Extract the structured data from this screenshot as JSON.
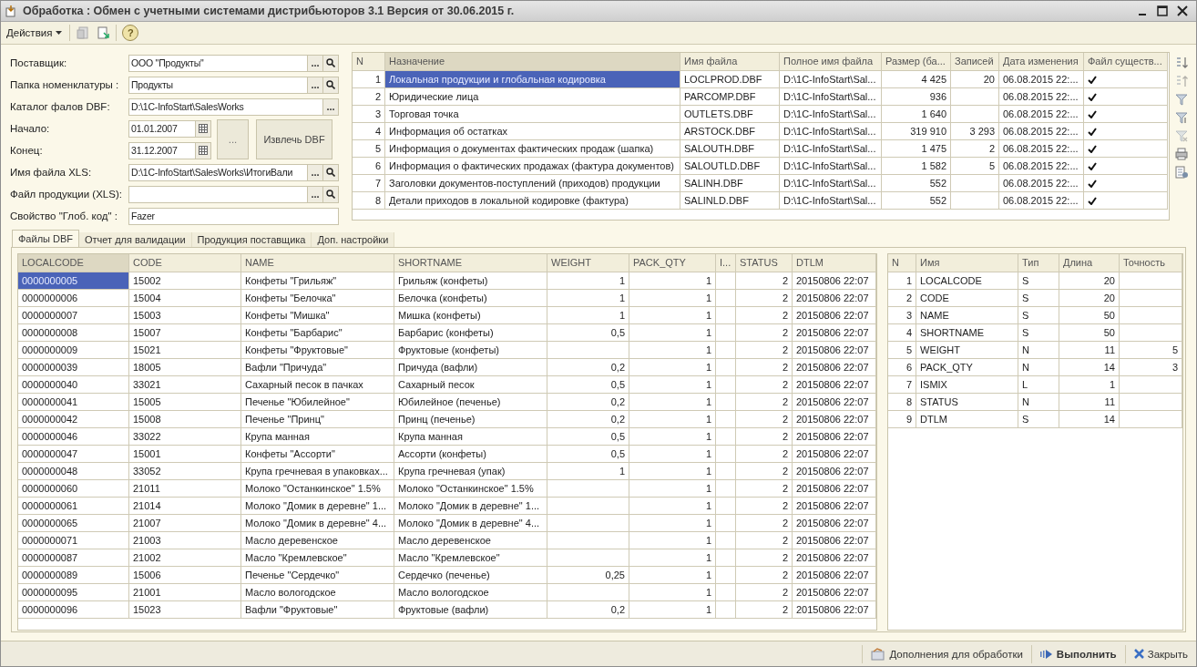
{
  "window": {
    "title": "Обработка : Обмен с учетными системами дистрибьюторов 3.1 Версия от 30.06.2015 г."
  },
  "toolbar": {
    "actions_menu": "Действия",
    "help": "?"
  },
  "form": {
    "fields": [
      {
        "label": "Поставщик:",
        "value": "ООО \"Продукты\"",
        "kind": "lookup"
      },
      {
        "label": "Папка номенклатуры :",
        "value": "Продукты",
        "kind": "lookup"
      },
      {
        "label": "Каталог фалов DBF:",
        "value": "D:\\1C-InfoStart\\SalesWorks",
        "kind": "select"
      },
      {
        "label": "Начало:",
        "value": "01.01.2007",
        "kind": "date"
      },
      {
        "label": "Конец:",
        "value": "31.12.2007",
        "kind": "date"
      },
      {
        "label": "Имя файла XLS:",
        "value": "D:\\1C-InfoStart\\SalesWorks\\ИтогиВали",
        "kind": "lookup"
      },
      {
        "label": "Файл продукции (XLS):",
        "kind": "lookup"
      },
      {
        "label": "Свойство \"Глоб. код\" :",
        "value": "Fazer",
        "kind": "text"
      }
    ],
    "buttons": [
      "...",
      "Извлечь DBF"
    ],
    "select_button": "..."
  },
  "files_table": {
    "columns": [
      "N",
      "Назначение",
      "Имя файла",
      "Полное имя файла",
      "Размер (ба...",
      "Записей",
      "Дата изменения",
      "Файл существ..."
    ],
    "rows": [
      {
        "n": "1",
        "purpose": "Локальная продукции и глобальная кодировка",
        "file": "LOCLPROD.DBF",
        "full_name": "D:\\1C-InfoStart\\Sal...",
        "size": "4 425",
        "records": "20",
        "modified": "06.08.2015 22:...",
        "exists": true,
        "selected": true
      },
      {
        "n": "2",
        "purpose": "Юридические лица",
        "file": "PARCOMP.DBF",
        "full_name": "D:\\1C-InfoStart\\Sal...",
        "size": "936",
        "modified": "06.08.2015 22:...",
        "exists": true,
        "selected": false
      },
      {
        "n": "3",
        "purpose": "Торговая точка",
        "file": "OUTLETS.DBF",
        "full_name": "D:\\1C-InfoStart\\Sal...",
        "size": "1 640",
        "modified": "06.08.2015 22:...",
        "exists": true,
        "selected": false
      },
      {
        "n": "4",
        "purpose": "Информация об остатках",
        "file": "ARSTOCK.DBF",
        "full_name": "D:\\1C-InfoStart\\Sal...",
        "size": "319 910",
        "records": "3 293",
        "modified": "06.08.2015 22:...",
        "exists": true,
        "selected": false
      },
      {
        "n": "5",
        "purpose": "Информация о документах фактических продаж (шапка)",
        "file": "SALOUTH.DBF",
        "full_name": "D:\\1C-InfoStart\\Sal...",
        "size": "1 475",
        "records": "2",
        "modified": "06.08.2015 22:...",
        "exists": true,
        "selected": false
      },
      {
        "n": "6",
        "purpose": "Информация о фактических продажах (фактура документов)",
        "file": "SALOUTLD.DBF",
        "full_name": "D:\\1C-InfoStart\\Sal...",
        "size": "1 582",
        "records": "5",
        "modified": "06.08.2015 22:...",
        "exists": true,
        "selected": false
      },
      {
        "n": "7",
        "purpose": "Заголовки документов-поступлений (приходов) продукции",
        "file": "SALINH.DBF",
        "full_name": "D:\\1C-InfoStart\\Sal...",
        "size": "552",
        "modified": "06.08.2015 22:...",
        "exists": true,
        "selected": false
      },
      {
        "n": "8",
        "purpose": "Детали приходов в локальной кодировке (фактура)",
        "file": "SALINLD.DBF",
        "full_name": "D:\\1C-InfoStart\\Sal...",
        "size": "552",
        "modified": "06.08.2015 22:...",
        "exists": true,
        "selected": false
      }
    ]
  },
  "tabs": [
    {
      "label": "Файлы DBF",
      "selected": true
    },
    {
      "label": "Отчет для  валидации",
      "selected": false
    },
    {
      "label": "Продукция поставщика",
      "selected": false
    },
    {
      "label": "Доп. настройки",
      "selected": false
    }
  ],
  "data_table": {
    "columns": [
      "LOCALCODE",
      "CODE",
      "NAME",
      "SHORTNAME",
      "WEIGHT",
      "PACK_QTY",
      "I...",
      "STATUS",
      "DTLM"
    ],
    "rows": [
      {
        "selected": true,
        "cells": [
          "0000000005",
          "15002",
          "Конфеты \"Грильяж\"",
          "Грильяж (конфеты)",
          "1",
          "1",
          null,
          "2",
          "20150806 22:07"
        ]
      },
      {
        "selected": false,
        "cells": [
          "0000000006",
          "15004",
          "Конфеты \"Белочка\"",
          "Белочка (конфеты)",
          "1",
          "1",
          null,
          "2",
          "20150806 22:07"
        ]
      },
      {
        "selected": false,
        "cells": [
          "0000000007",
          "15003",
          "Конфеты \"Мишка\"",
          "Мишка (конфеты)",
          "1",
          "1",
          null,
          "2",
          "20150806 22:07"
        ]
      },
      {
        "selected": false,
        "cells": [
          "0000000008",
          "15007",
          "Конфеты \"Барбарис\"",
          "Барбарис (конфеты)",
          "0,5",
          "1",
          null,
          "2",
          "20150806 22:07"
        ]
      },
      {
        "selected": false,
        "cells": [
          "0000000009",
          "15021",
          "Конфеты \"Фруктовые\"",
          "Фруктовые (конфеты)",
          null,
          "1",
          null,
          "2",
          "20150806 22:07"
        ]
      },
      {
        "selected": false,
        "cells": [
          "0000000039",
          "18005",
          "Вафли \"Причуда\"",
          "Причуда (вафли)",
          "0,2",
          "1",
          null,
          "2",
          "20150806 22:07"
        ]
      },
      {
        "selected": false,
        "cells": [
          "0000000040",
          "33021",
          "Сахарный песок в пачках",
          "Сахарный песок",
          "0,5",
          "1",
          null,
          "2",
          "20150806 22:07"
        ]
      },
      {
        "selected": false,
        "cells": [
          "0000000041",
          "15005",
          "Печенье \"Юбилейное\"",
          "Юбилейное (печенье)",
          "0,2",
          "1",
          null,
          "2",
          "20150806 22:07"
        ]
      },
      {
        "selected": false,
        "cells": [
          "0000000042",
          "15008",
          "Печенье \"Принц\"",
          "Принц (печенье)",
          "0,2",
          "1",
          null,
          "2",
          "20150806 22:07"
        ]
      },
      {
        "selected": false,
        "cells": [
          "0000000046",
          "33022",
          "Крупа манная",
          "Крупа манная",
          "0,5",
          "1",
          null,
          "2",
          "20150806 22:07"
        ]
      },
      {
        "selected": false,
        "cells": [
          "0000000047",
          "15001",
          "Конфеты \"Ассорти\"",
          "Ассорти (конфеты)",
          "0,5",
          "1",
          null,
          "2",
          "20150806 22:07"
        ]
      },
      {
        "selected": false,
        "cells": [
          "0000000048",
          "33052",
          "Крупа гречневая в упаковках...",
          "Крупа гречневая (упак)",
          "1",
          "1",
          null,
          "2",
          "20150806 22:07"
        ]
      },
      {
        "selected": false,
        "cells": [
          "0000000060",
          "21011",
          "Молоко \"Останкинское\" 1.5%",
          "Молоко \"Останкинское\" 1.5%",
          null,
          "1",
          null,
          "2",
          "20150806 22:07"
        ]
      },
      {
        "selected": false,
        "cells": [
          "0000000061",
          "21014",
          "Молоко \"Домик в деревне\" 1...",
          "Молоко \"Домик в деревне\" 1...",
          null,
          "1",
          null,
          "2",
          "20150806 22:07"
        ]
      },
      {
        "selected": false,
        "cells": [
          "0000000065",
          "21007",
          "Молоко \"Домик в деревне\" 4...",
          "Молоко \"Домик в деревне\" 4...",
          null,
          "1",
          null,
          "2",
          "20150806 22:07"
        ]
      },
      {
        "selected": false,
        "cells": [
          "0000000071",
          "21003",
          "Масло деревенское",
          "Масло деревенское",
          null,
          "1",
          null,
          "2",
          "20150806 22:07"
        ]
      },
      {
        "selected": false,
        "cells": [
          "0000000087",
          "21002",
          "Масло \"Кремлевское\"",
          "Масло \"Кремлевское\"",
          null,
          "1",
          null,
          "2",
          "20150806 22:07"
        ]
      },
      {
        "selected": false,
        "cells": [
          "0000000089",
          "15006",
          "Печенье \"Сердечко\"",
          "Сердечко (печенье)",
          "0,25",
          "1",
          null,
          "2",
          "20150806 22:07"
        ]
      },
      {
        "selected": false,
        "cells": [
          "0000000095",
          "21001",
          "Масло вологодское",
          "Масло вологодское",
          null,
          "1",
          null,
          "2",
          "20150806 22:07"
        ]
      },
      {
        "selected": false,
        "cells": [
          "0000000096",
          "15023",
          "Вафли \"Фруктовые\"",
          "Фруктовые (вафли)",
          "0,2",
          "1",
          null,
          "2",
          "20150806 22:07"
        ]
      }
    ]
  },
  "fields_table": {
    "columns": [
      "N",
      "Имя",
      "Тип",
      "Длина",
      "Точность"
    ],
    "rows": [
      {
        "cells": [
          "1",
          "LOCALCODE",
          "S",
          "20",
          null
        ]
      },
      {
        "cells": [
          "2",
          "CODE",
          "S",
          "20",
          null
        ]
      },
      {
        "cells": [
          "3",
          "NAME",
          "S",
          "50",
          null
        ]
      },
      {
        "cells": [
          "4",
          "SHORTNAME",
          "S",
          "50",
          null
        ]
      },
      {
        "cells": [
          "5",
          "WEIGHT",
          "N",
          "11",
          "5"
        ]
      },
      {
        "cells": [
          "6",
          "PACK_QTY",
          "N",
          "14",
          "3"
        ]
      },
      {
        "cells": [
          "7",
          "ISMIX",
          "L",
          "1",
          null
        ]
      },
      {
        "cells": [
          "8",
          "STATUS",
          "N",
          "11",
          null
        ]
      },
      {
        "cells": [
          "9",
          "DTLM",
          "S",
          "14",
          null
        ]
      }
    ]
  },
  "footer": {
    "buttons": [
      {
        "label": "Дополнения для обработки",
        "kind": "extras"
      },
      {
        "label": "Выполнить",
        "kind": "run"
      },
      {
        "label": "Закрыть",
        "kind": "close"
      }
    ]
  }
}
